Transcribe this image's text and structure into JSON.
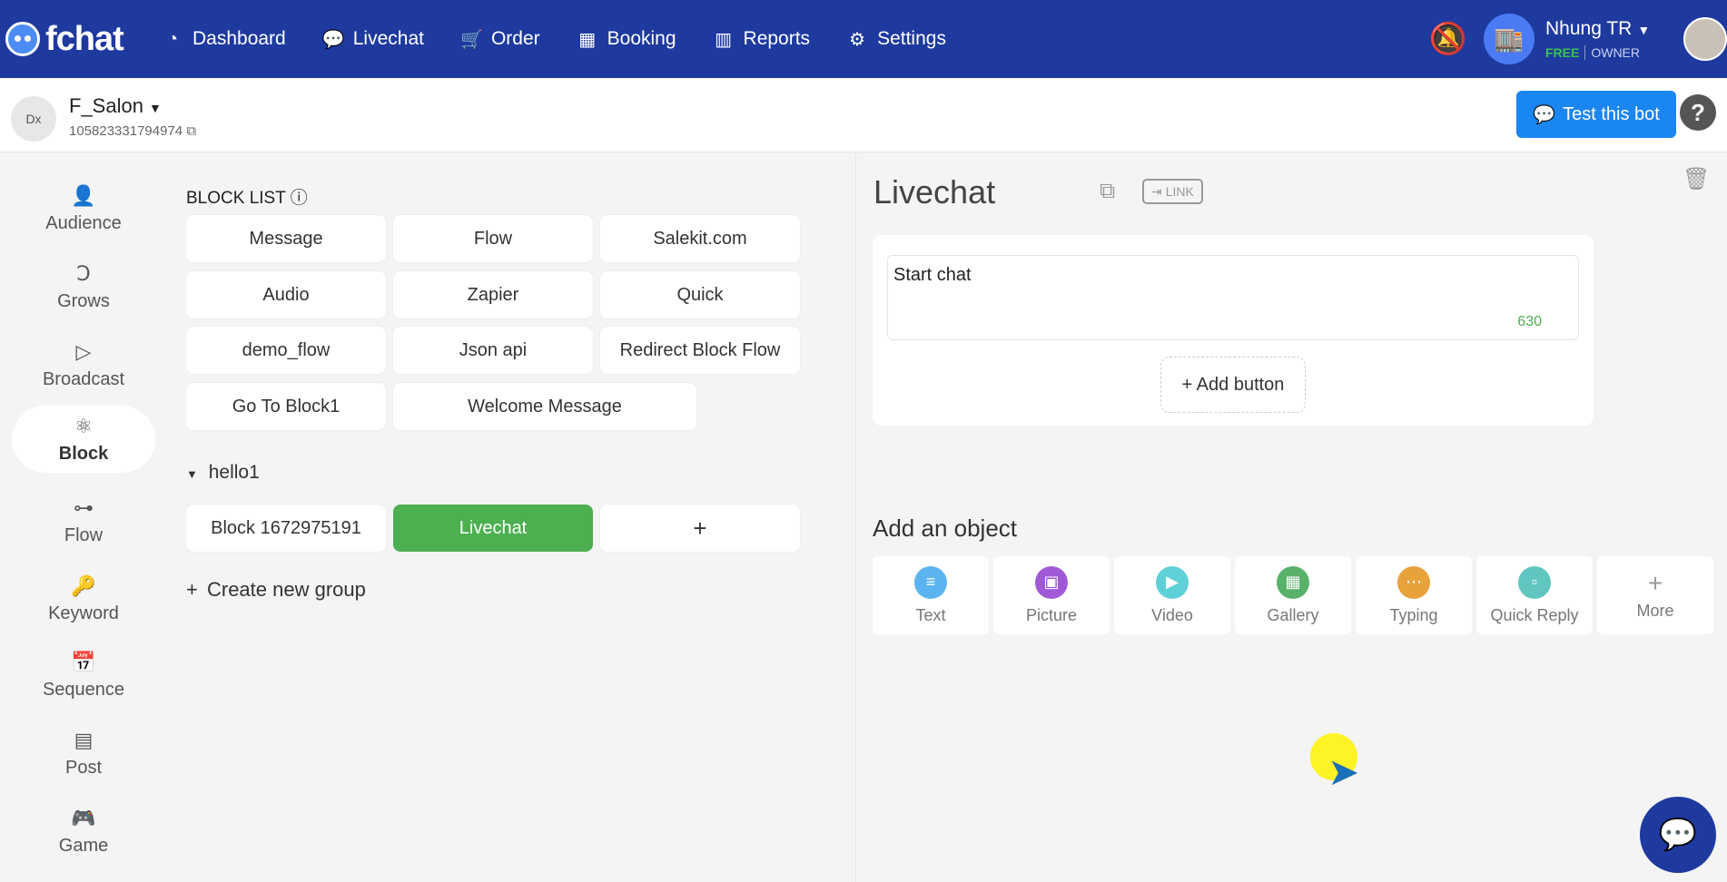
{
  "brand": {
    "name": "fchat"
  },
  "nav": [
    {
      "label": "Dashboard",
      "icon": "dashboard-icon"
    },
    {
      "label": "Livechat",
      "icon": "messenger-icon"
    },
    {
      "label": "Order",
      "icon": "cart-icon"
    },
    {
      "label": "Booking",
      "icon": "calendar-icon"
    },
    {
      "label": "Reports",
      "icon": "chart-icon"
    },
    {
      "label": "Settings",
      "icon": "gear-icon"
    }
  ],
  "user": {
    "name": "Nhung TR",
    "plan": "FREE",
    "role": "OWNER"
  },
  "page": {
    "name": "F_Salon",
    "id": "105823331794974"
  },
  "header_actions": {
    "test_bot": "Test this bot",
    "help": "?"
  },
  "sidebar": [
    {
      "label": "Audience",
      "icon": "user-icon",
      "active": false
    },
    {
      "label": "Grows",
      "icon": "grows-icon",
      "active": false
    },
    {
      "label": "Broadcast",
      "icon": "send-icon",
      "active": false
    },
    {
      "label": "Block",
      "icon": "atom-icon",
      "active": true
    },
    {
      "label": "Flow",
      "icon": "flow-icon",
      "active": false
    },
    {
      "label": "Keyword",
      "icon": "key-icon",
      "active": false
    },
    {
      "label": "Sequence",
      "icon": "calendar-check-icon",
      "active": false
    },
    {
      "label": "Post",
      "icon": "table-icon",
      "active": false
    },
    {
      "label": "Game",
      "icon": "gamepad-icon",
      "active": false
    }
  ],
  "block_list": {
    "title": "BLOCK LIST",
    "items": [
      "Message",
      "Flow",
      "Salekit.com",
      "Audio",
      "Zapier",
      "Quick",
      "demo_flow",
      "Json api",
      "Redirect Block Flow",
      "Go To Block1",
      "Welcome Message"
    ]
  },
  "group": {
    "name": "hello1",
    "items": [
      "Block 1672975191",
      "Livechat",
      "+"
    ],
    "selected": "Livechat"
  },
  "create_group": "Create new group",
  "editor": {
    "title": "Livechat",
    "link_label": "LINK",
    "message_text": "Start chat",
    "char_count": "630",
    "add_button": "+ Add button",
    "add_object_title": "Add an object",
    "objects": [
      {
        "label": "Text",
        "color": "#5bb4ef"
      },
      {
        "label": "Picture",
        "color": "#a05ad8"
      },
      {
        "label": "Video",
        "color": "#5fd0d8"
      },
      {
        "label": "Gallery",
        "color": "#58b26a"
      },
      {
        "label": "Typing",
        "color": "#e8a23c"
      },
      {
        "label": "Quick Reply",
        "color": "#62c6c0"
      },
      {
        "label": "More",
        "color": "#999999"
      }
    ]
  },
  "colors": {
    "topbar": "#1e3a9f",
    "accent": "#1a86f2",
    "selected_block": "#4caf50"
  }
}
